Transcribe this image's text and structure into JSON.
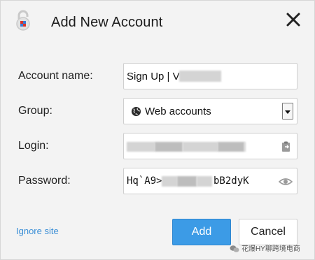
{
  "dialog": {
    "title": "Add New Account",
    "close_icon": "close-icon",
    "app_icon": "lock-logo-icon"
  },
  "form": {
    "account_name": {
      "label": "Account name:",
      "value": "Sign Up | V"
    },
    "group": {
      "label": "Group:",
      "value": "Web accounts",
      "icon": "globe-icon"
    },
    "login": {
      "label": "Login:",
      "icon": "paste-icon"
    },
    "password": {
      "label": "Password:",
      "value_start": "Hq`A9>",
      "value_end": "bB2dyK",
      "icon": "eye-icon"
    }
  },
  "footer": {
    "ignore_link": "Ignore site",
    "add_label": "Add",
    "cancel_label": "Cancel"
  },
  "watermark": {
    "text": "花爆HY聊跨境电商"
  }
}
